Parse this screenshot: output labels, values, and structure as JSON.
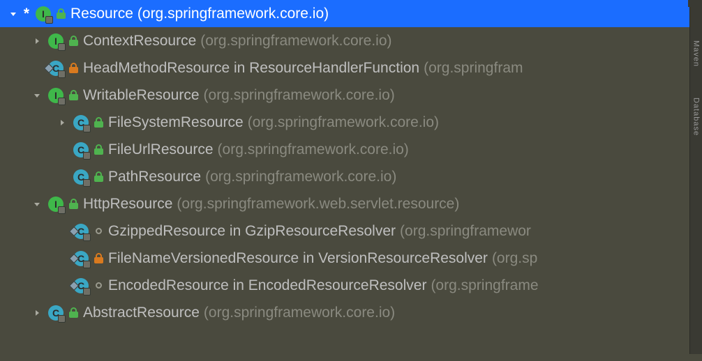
{
  "star": "*",
  "rows": [
    {
      "id": "resource",
      "name": "Resource",
      "pkg": "(org.springframework.core.io)",
      "expand": "down",
      "icon": "interface",
      "vis": "green-lock",
      "starred": true,
      "selected": true,
      "indent": 0,
      "diamond": false
    },
    {
      "id": "context-resource",
      "name": "ContextResource",
      "pkg": "(org.springframework.core.io)",
      "expand": "right",
      "icon": "interface",
      "vis": "green-lock",
      "starred": false,
      "selected": false,
      "indent": 1,
      "diamond": false
    },
    {
      "id": "head-method-resource",
      "name": "HeadMethodResource in ResourceHandlerFunction",
      "pkg": "(org.springfram",
      "expand": "none",
      "icon": "class",
      "vis": "orange-lock",
      "starred": false,
      "selected": false,
      "indent": 1,
      "diamond": true
    },
    {
      "id": "writable-resource",
      "name": "WritableResource",
      "pkg": "(org.springframework.core.io)",
      "expand": "down",
      "icon": "interface",
      "vis": "green-lock",
      "starred": false,
      "selected": false,
      "indent": 1,
      "diamond": false
    },
    {
      "id": "file-system-resource",
      "name": "FileSystemResource",
      "pkg": "(org.springframework.core.io)",
      "expand": "right",
      "icon": "class",
      "vis": "green-lock",
      "starred": false,
      "selected": false,
      "indent": 2,
      "diamond": false
    },
    {
      "id": "file-url-resource",
      "name": "FileUrlResource",
      "pkg": "(org.springframework.core.io)",
      "expand": "none",
      "icon": "class",
      "vis": "green-lock",
      "starred": false,
      "selected": false,
      "indent": 2,
      "diamond": false
    },
    {
      "id": "path-resource",
      "name": "PathResource",
      "pkg": "(org.springframework.core.io)",
      "expand": "none",
      "icon": "class",
      "vis": "green-lock",
      "starred": false,
      "selected": false,
      "indent": 2,
      "diamond": false
    },
    {
      "id": "http-resource",
      "name": "HttpResource",
      "pkg": "(org.springframework.web.servlet.resource)",
      "expand": "down",
      "icon": "interface",
      "vis": "green-lock",
      "starred": false,
      "selected": false,
      "indent": 1,
      "diamond": false
    },
    {
      "id": "gzipped-resource",
      "name": "GzippedResource in GzipResourceResolver",
      "pkg": "(org.springframewor",
      "expand": "none",
      "icon": "class",
      "vis": "pkg-private",
      "starred": false,
      "selected": false,
      "indent": 2,
      "diamond": true
    },
    {
      "id": "filename-versioned-resource",
      "name": "FileNameVersionedResource in VersionResourceResolver",
      "pkg": "(org.sp",
      "expand": "none",
      "icon": "class",
      "vis": "orange-lock",
      "starred": false,
      "selected": false,
      "indent": 2,
      "diamond": true
    },
    {
      "id": "encoded-resource",
      "name": "EncodedResource in EncodedResourceResolver",
      "pkg": "(org.springframe",
      "expand": "none",
      "icon": "class",
      "vis": "pkg-private",
      "starred": false,
      "selected": false,
      "indent": 2,
      "diamond": true
    },
    {
      "id": "abstract-resource",
      "name": "AbstractResource",
      "pkg": "(org.springframework.core.io)",
      "expand": "right",
      "icon": "class",
      "vis": "green-lock",
      "starred": false,
      "selected": false,
      "indent": 1,
      "diamond": false
    }
  ],
  "sidebar": {
    "label1": "Maven",
    "label2": "Database"
  }
}
